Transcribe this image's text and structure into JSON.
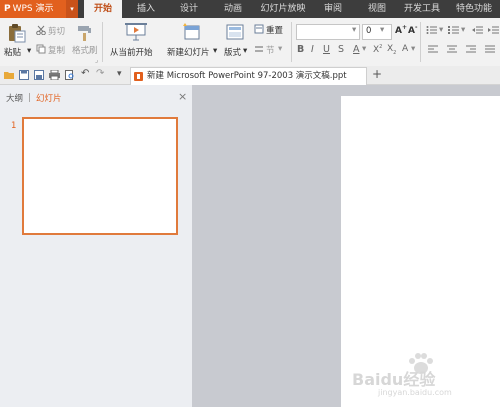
{
  "app": {
    "brand": "WPS 演示"
  },
  "menu": {
    "tabs": [
      "开始",
      "插入",
      "设计",
      "动画",
      "幻灯片放映",
      "审阅",
      "视图",
      "开发工具",
      "特色功能"
    ],
    "active_tab": "开始"
  },
  "ribbon": {
    "paste": "粘贴",
    "cut": "剪切",
    "copy": "复制",
    "format_painter": "格式刷",
    "from_current": "从当前开始",
    "new_slide": "新建幻灯片",
    "layout": "版式",
    "reset": "重置",
    "section": "节",
    "font_size": "0"
  },
  "document": {
    "tab_title": "新建 Microsoft PowerPoint 97-2003 演示文稿.ppt",
    "add_tab": "+"
  },
  "sidebar": {
    "tab_outline": "大纲",
    "tab_slides": "幻灯片",
    "close": "×",
    "slide_number": "1"
  },
  "watermark": {
    "text": "Baidu经验",
    "url": "jingyan.baidu.com"
  },
  "colors": {
    "brand": "#e2601e",
    "menu_bg": "#3d3d3d",
    "ribbon_bg": "#f2f2f2",
    "work_bg": "#c8cad0",
    "accent": "#e07a3c"
  }
}
